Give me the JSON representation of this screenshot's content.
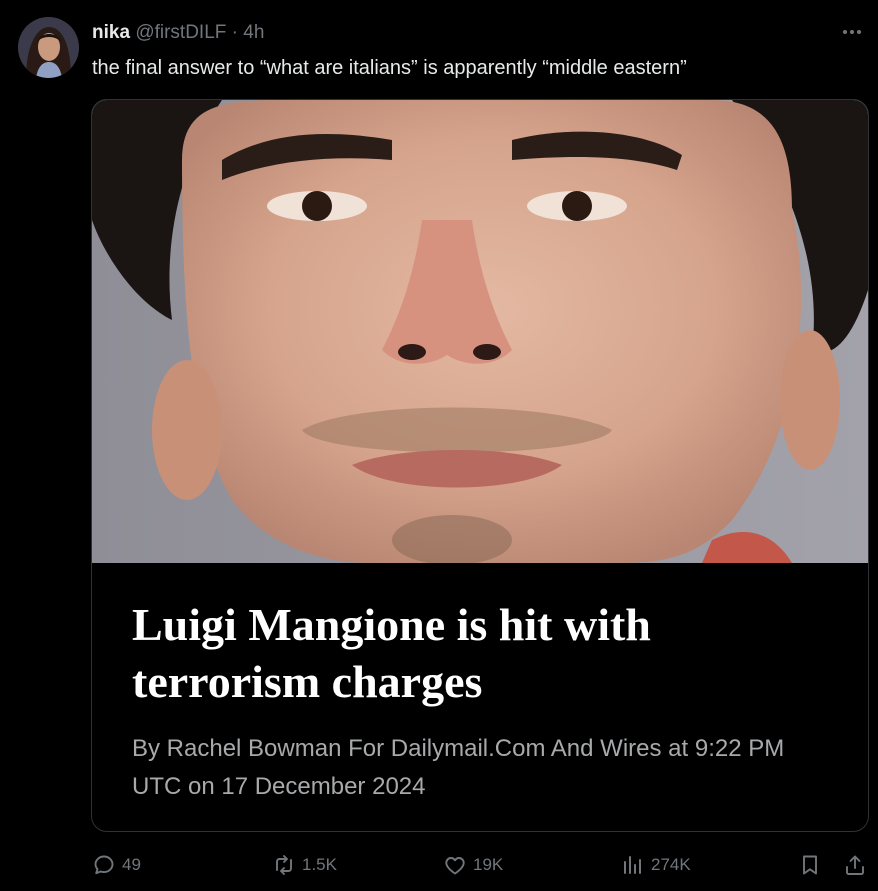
{
  "author": {
    "name": "nika",
    "handle": "@firstDILF",
    "separator": "·",
    "time": "4h"
  },
  "tweet": {
    "text": "the final answer to “what are italians” is apparently “middle eastern”"
  },
  "card": {
    "headline": "Luigi Mangione is hit with terrorism charges",
    "byline": "By Rachel Bowman For Dailymail.Com And Wires at 9:22 PM UTC on 17 December 2024"
  },
  "actions": {
    "replies": "49",
    "reposts": "1.5K",
    "likes": "19K",
    "views": "274K"
  },
  "icons": {
    "more": "more-icon",
    "reply": "reply-icon",
    "repost": "repost-icon",
    "like": "heart-icon",
    "views": "views-icon",
    "bookmark": "bookmark-icon",
    "share": "share-icon"
  },
  "colors": {
    "background": "#000000",
    "text_primary": "#e7e9ea",
    "text_secondary": "#71767b",
    "card_border": "#2f3336",
    "byline": "#a7a9ab"
  }
}
